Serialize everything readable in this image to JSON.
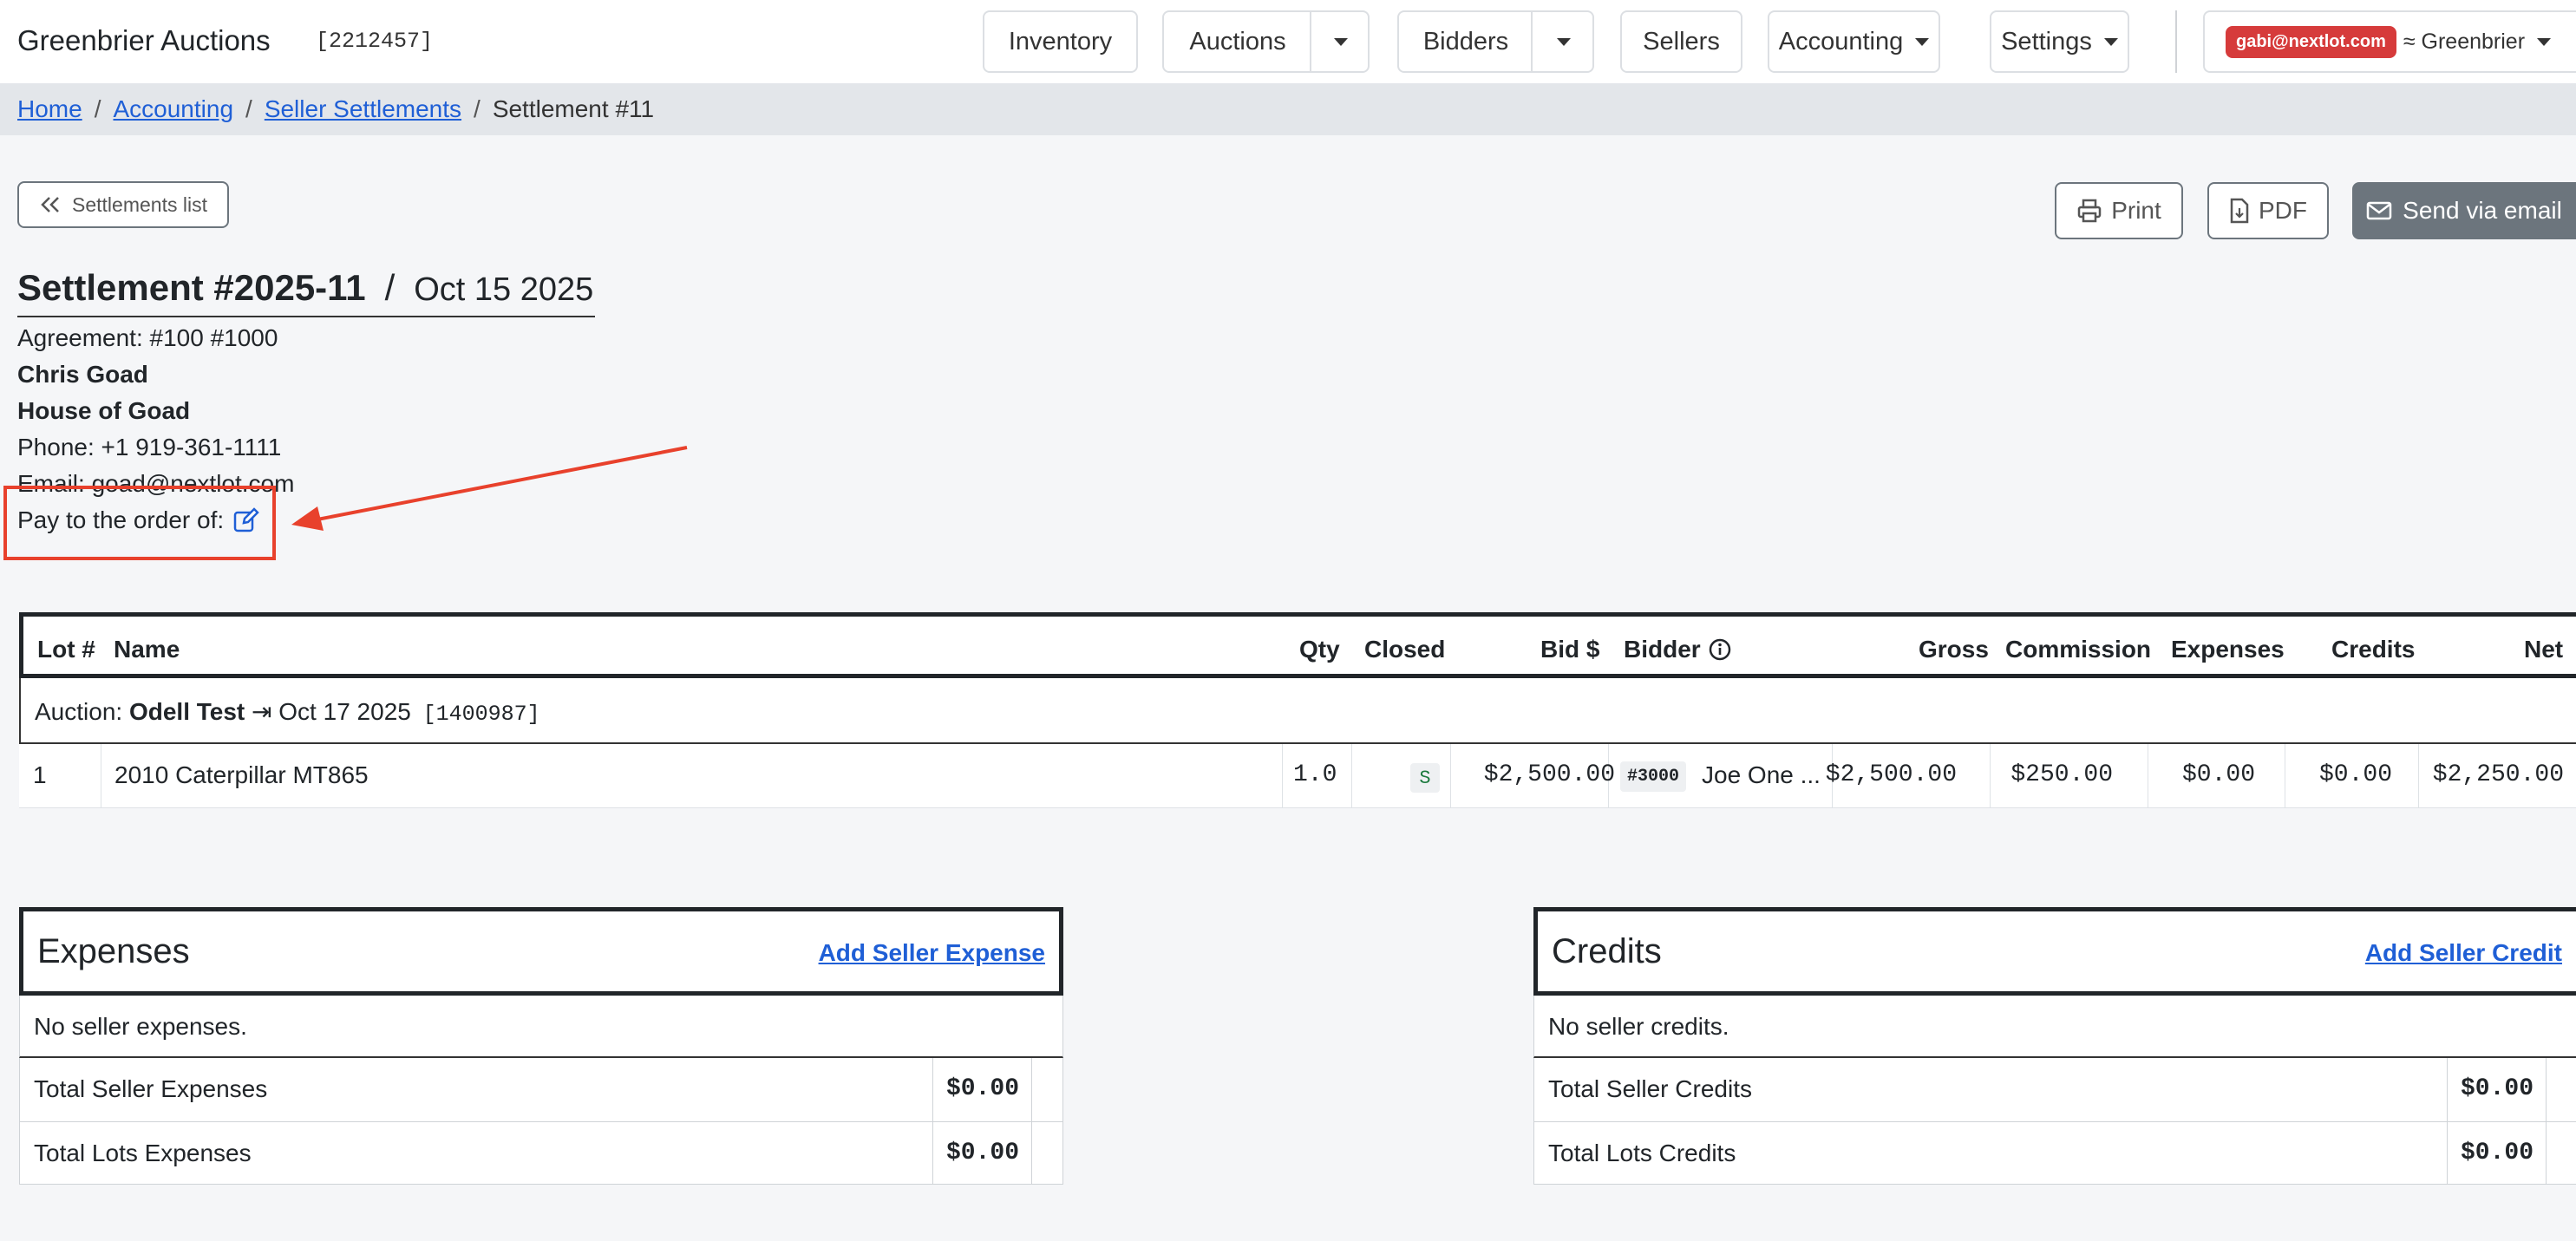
{
  "nav": {
    "brand": "Greenbrier Auctions",
    "brand_id": "[2212457]",
    "inventory": "Inventory",
    "auctions": "Auctions",
    "bidders": "Bidders",
    "sellers": "Sellers",
    "accounting": "Accounting",
    "settings": "Settings",
    "user_email": "gabi@nextlot.com",
    "org": "≈ Greenbrier"
  },
  "breadcrumb": {
    "home": "Home",
    "accounting": "Accounting",
    "seller_settlements": "Seller Settlements",
    "current": "Settlement #11",
    "sep": "/"
  },
  "actions": {
    "settlements_list": "Settlements list",
    "print": "Print",
    "pdf": "PDF",
    "send_email": "Send via email"
  },
  "settlement": {
    "title": "Settlement #2025-11",
    "slash": "/",
    "date": "Oct 15 2025",
    "agreement": "Agreement: #100 #1000",
    "seller_name": "Chris Goad",
    "company": "House of Goad",
    "phone": "Phone: +1 919-361-1111",
    "email": "Email: goad@nextlot.com",
    "pay_to": "Pay to the order of:"
  },
  "lots_table": {
    "headers": {
      "lot": "Lot #",
      "name": "Name",
      "qty": "Qty",
      "closed": "Closed",
      "bid": "Bid $",
      "bidder": "Bidder",
      "gross": "Gross",
      "commission": "Commission",
      "expenses": "Expenses",
      "credits": "Credits",
      "net": "Net"
    },
    "auction": {
      "prefix": "Auction:",
      "name": "Odell Test",
      "arrow": "⇥",
      "date": "Oct 17 2025",
      "id": "[1400987]"
    },
    "rows": [
      {
        "lot": "1",
        "name": "2010 Caterpillar MT865",
        "qty": "1.0",
        "closed": "S",
        "bid": "$2,500.00",
        "bidder_num": "#3000",
        "bidder_name": "Joe One ...",
        "gross": "$2,500.00",
        "commission": "$250.00",
        "expenses": "$0.00",
        "credits": "$0.00",
        "net": "$2,250.00"
      }
    ]
  },
  "expenses": {
    "title": "Expenses",
    "add": "Add Seller Expense",
    "empty": "No seller expenses.",
    "total_seller_label": "Total Seller Expenses",
    "total_seller_value": "$0.00",
    "total_lots_label": "Total Lots Expenses",
    "total_lots_value": "$0.00"
  },
  "credits": {
    "title": "Credits",
    "add": "Add Seller Credit",
    "empty": "No seller credits.",
    "total_seller_label": "Total Seller Credits",
    "total_seller_value": "$0.00",
    "total_lots_label": "Total Lots Credits",
    "total_lots_value": "$0.00"
  },
  "colors": {
    "accent": "#e8412c",
    "link": "#1f5fd6",
    "email_badge": "#d63b3b",
    "send_button": "#6c757d"
  }
}
